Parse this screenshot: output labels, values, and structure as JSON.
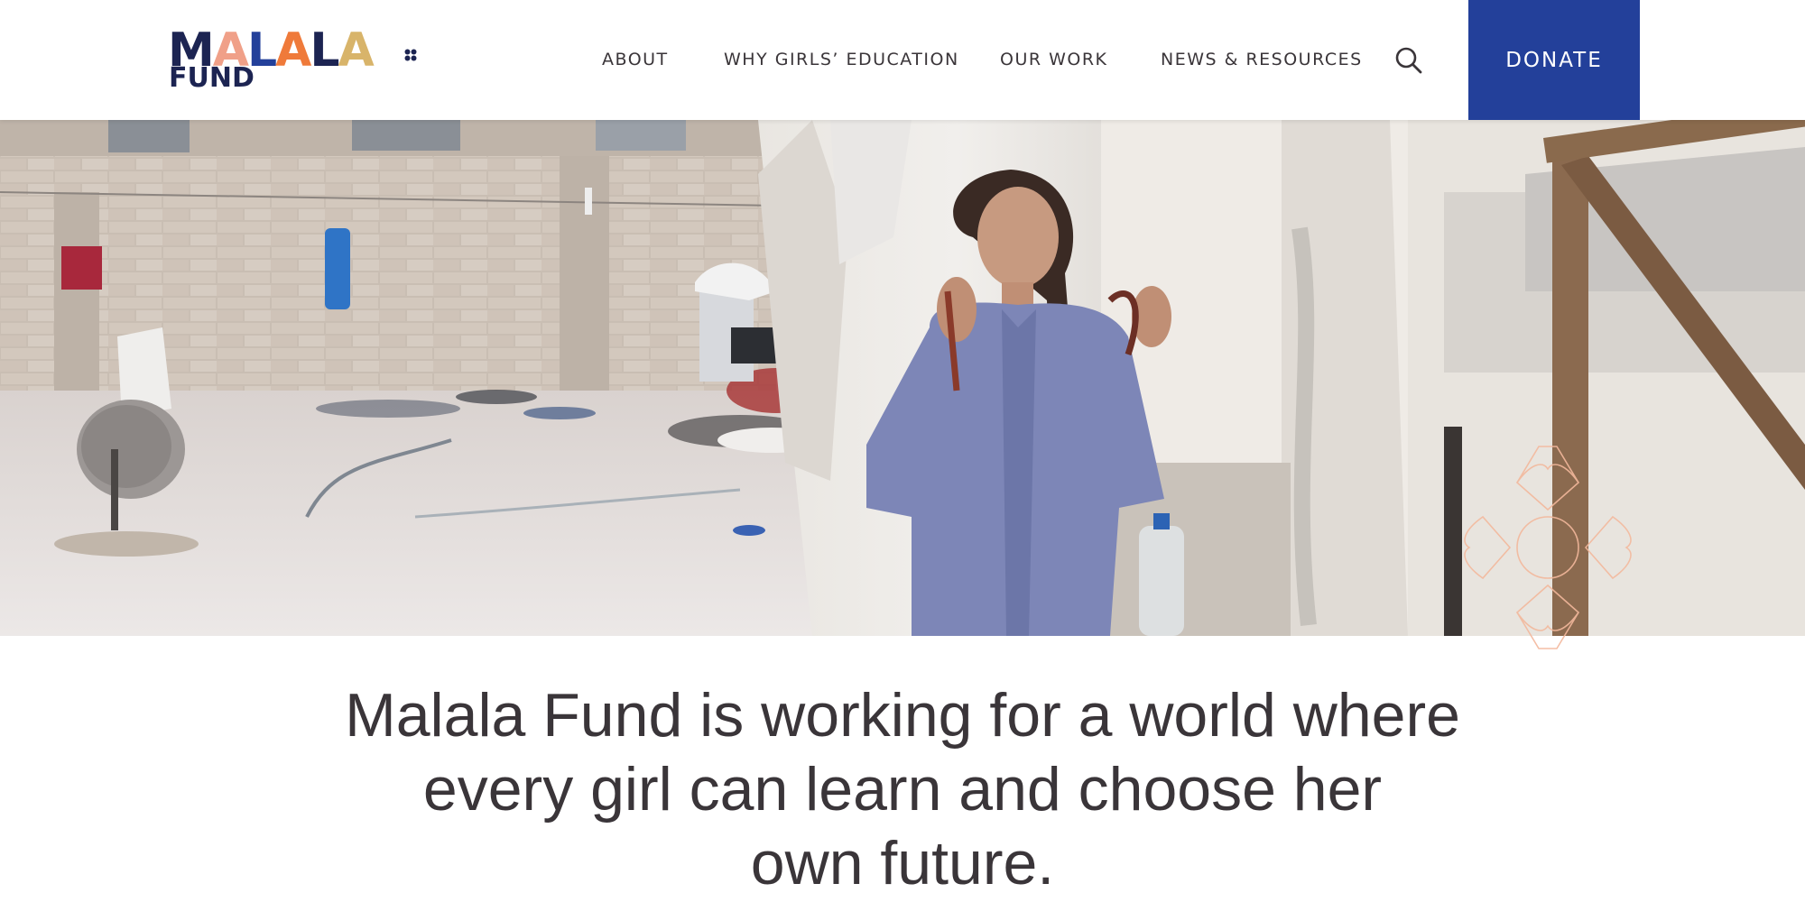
{
  "logo": {
    "letters": [
      "M",
      "A",
      "L",
      "A",
      "L",
      "A"
    ],
    "letter_colors": [
      "#1c2452",
      "#f0a088",
      "#23409a",
      "#ef7a3a",
      "#1c2452",
      "#d8b46a"
    ],
    "subtitle": "FUND"
  },
  "nav": {
    "items": [
      {
        "label": "ABOUT"
      },
      {
        "label": "WHY GIRLS’ EDUCATION"
      },
      {
        "label": "OUR WORK"
      },
      {
        "label": "NEWS & RESOURCES"
      }
    ],
    "search_icon": "search-icon",
    "donate_label": "DONATE"
  },
  "colors": {
    "donate_bg": "#23409a",
    "text": "#3a3539",
    "decor": "#f3b89c"
  },
  "hero": {
    "description_icon": "hero-photo"
  },
  "mission": {
    "line1": "Malala Fund is working for a world where",
    "line2": "every girl can learn and choose her",
    "line3": "own future."
  }
}
